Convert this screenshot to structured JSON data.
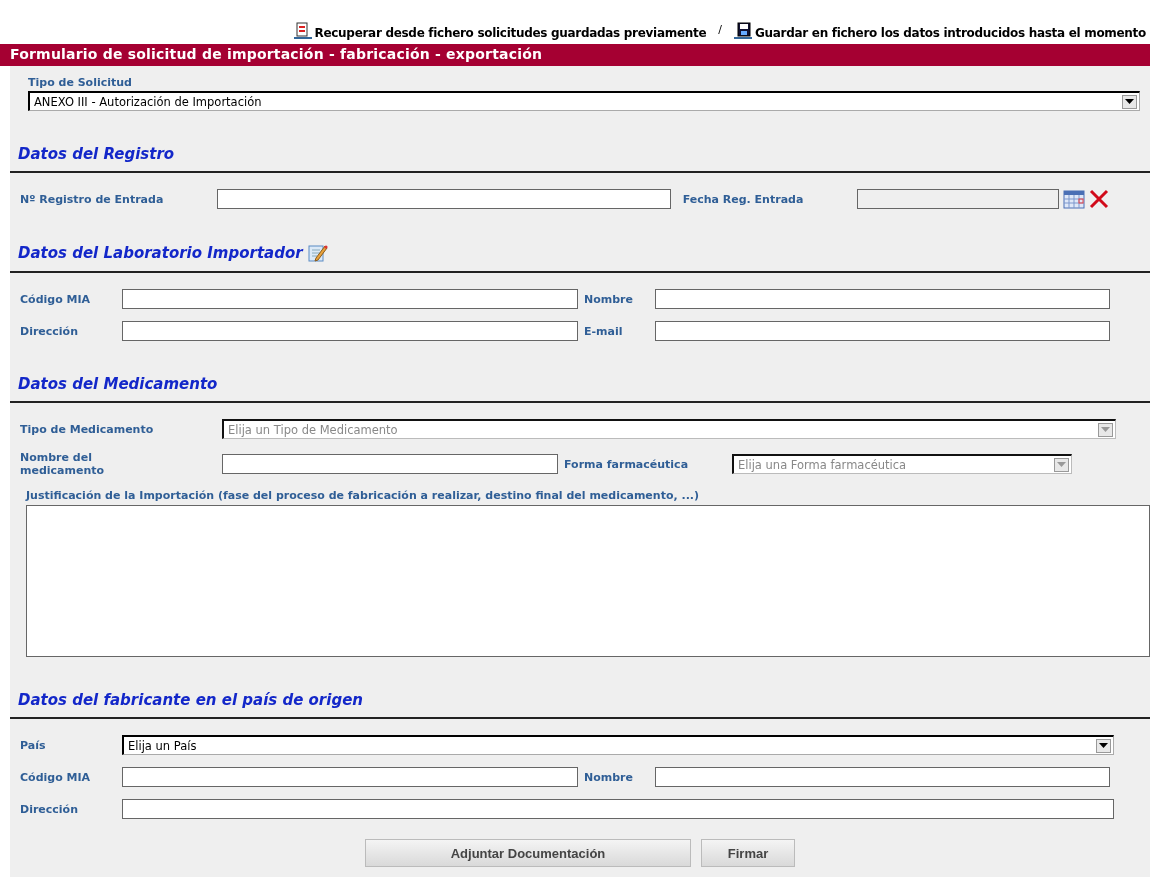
{
  "toolbar": {
    "links": [
      {
        "kind": "open",
        "label": "Recuperar desde fichero solicitudes guardadas previamente"
      },
      {
        "kind": "save",
        "label": "Guardar en fichero los datos introducidos hasta el momento"
      }
    ],
    "separator": "/"
  },
  "form_title": "Formulario de solicitud de importación - fabricación - exportación",
  "request_type": {
    "label": "Tipo de Solicitud",
    "value": "ANEXO III - Autorización de Importación",
    "disabled": false
  },
  "sections": [
    {
      "kind": "registro",
      "title": "Datos del Registro",
      "editable": false,
      "rows": [
        [
          {
            "kind": "text",
            "label": "Nº Registro de Entrada"
          },
          {
            "kind": "date",
            "label": "Fecha Reg. Entrada",
            "disabled": true
          }
        ]
      ]
    },
    {
      "kind": "laboratorio",
      "title": "Datos del Laboratorio Importador",
      "editable": true,
      "rows": [
        [
          {
            "kind": "text",
            "label": "Código MIA"
          },
          {
            "kind": "text",
            "label": "Nombre"
          }
        ],
        [
          {
            "kind": "text",
            "label": "Dirección"
          },
          {
            "kind": "text",
            "label": "E-mail"
          }
        ]
      ]
    },
    {
      "kind": "medicamento",
      "title": "Datos del Medicamento",
      "editable": false,
      "rows": [
        [
          {
            "kind": "select",
            "label": "Tipo de Medicamento",
            "value": "Elija un Tipo de Medicamento",
            "disabled": true
          }
        ],
        [
          {
            "kind": "text",
            "label": "Nombre del medicamento"
          },
          {
            "kind": "select",
            "label": "Forma farmacéutica",
            "value": "Elija una Forma farmacéutica",
            "disabled": true
          }
        ],
        [
          {
            "kind": "textarea",
            "label": "Justificación de la Importación (fase del proceso de fabricación a realizar, destino final del medicamento, ...)"
          }
        ]
      ]
    },
    {
      "kind": "fabricante",
      "title": "Datos del fabricante en el país de origen",
      "editable": false,
      "rows": [
        [
          {
            "kind": "select",
            "label": "País",
            "value": "Elija un País",
            "disabled": false
          }
        ],
        [
          {
            "kind": "text",
            "label": "Código MIA"
          },
          {
            "kind": "text",
            "label": "Nombre"
          }
        ],
        [
          {
            "kind": "text",
            "label": "Dirección"
          }
        ]
      ]
    }
  ],
  "buttons": [
    {
      "label": "Adjuntar Documentación",
      "kind": "wide"
    },
    {
      "label": "Firmar",
      "kind": "narrow"
    }
  ]
}
